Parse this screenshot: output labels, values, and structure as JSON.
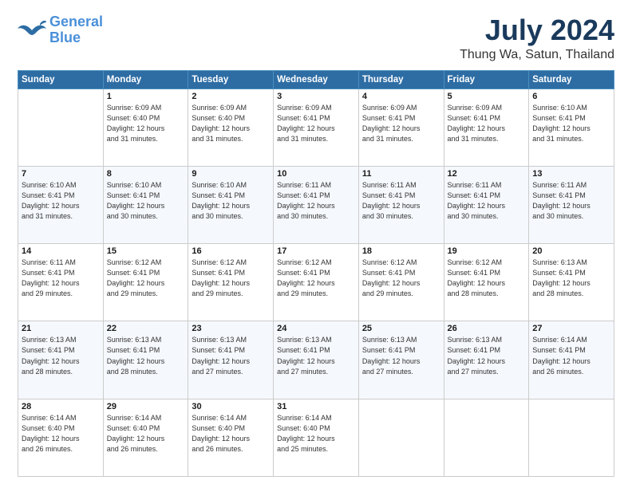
{
  "logo": {
    "line1": "General",
    "line2": "Blue"
  },
  "title": "July 2024",
  "subtitle": "Thung Wa, Satun, Thailand",
  "days_header": [
    "Sunday",
    "Monday",
    "Tuesday",
    "Wednesday",
    "Thursday",
    "Friday",
    "Saturday"
  ],
  "weeks": [
    [
      {
        "day": "",
        "info": ""
      },
      {
        "day": "1",
        "info": "Sunrise: 6:09 AM\nSunset: 6:40 PM\nDaylight: 12 hours\nand 31 minutes."
      },
      {
        "day": "2",
        "info": "Sunrise: 6:09 AM\nSunset: 6:40 PM\nDaylight: 12 hours\nand 31 minutes."
      },
      {
        "day": "3",
        "info": "Sunrise: 6:09 AM\nSunset: 6:41 PM\nDaylight: 12 hours\nand 31 minutes."
      },
      {
        "day": "4",
        "info": "Sunrise: 6:09 AM\nSunset: 6:41 PM\nDaylight: 12 hours\nand 31 minutes."
      },
      {
        "day": "5",
        "info": "Sunrise: 6:09 AM\nSunset: 6:41 PM\nDaylight: 12 hours\nand 31 minutes."
      },
      {
        "day": "6",
        "info": "Sunrise: 6:10 AM\nSunset: 6:41 PM\nDaylight: 12 hours\nand 31 minutes."
      }
    ],
    [
      {
        "day": "7",
        "info": "Sunrise: 6:10 AM\nSunset: 6:41 PM\nDaylight: 12 hours\nand 31 minutes."
      },
      {
        "day": "8",
        "info": "Sunrise: 6:10 AM\nSunset: 6:41 PM\nDaylight: 12 hours\nand 30 minutes."
      },
      {
        "day": "9",
        "info": "Sunrise: 6:10 AM\nSunset: 6:41 PM\nDaylight: 12 hours\nand 30 minutes."
      },
      {
        "day": "10",
        "info": "Sunrise: 6:11 AM\nSunset: 6:41 PM\nDaylight: 12 hours\nand 30 minutes."
      },
      {
        "day": "11",
        "info": "Sunrise: 6:11 AM\nSunset: 6:41 PM\nDaylight: 12 hours\nand 30 minutes."
      },
      {
        "day": "12",
        "info": "Sunrise: 6:11 AM\nSunset: 6:41 PM\nDaylight: 12 hours\nand 30 minutes."
      },
      {
        "day": "13",
        "info": "Sunrise: 6:11 AM\nSunset: 6:41 PM\nDaylight: 12 hours\nand 30 minutes."
      }
    ],
    [
      {
        "day": "14",
        "info": "Sunrise: 6:11 AM\nSunset: 6:41 PM\nDaylight: 12 hours\nand 29 minutes."
      },
      {
        "day": "15",
        "info": "Sunrise: 6:12 AM\nSunset: 6:41 PM\nDaylight: 12 hours\nand 29 minutes."
      },
      {
        "day": "16",
        "info": "Sunrise: 6:12 AM\nSunset: 6:41 PM\nDaylight: 12 hours\nand 29 minutes."
      },
      {
        "day": "17",
        "info": "Sunrise: 6:12 AM\nSunset: 6:41 PM\nDaylight: 12 hours\nand 29 minutes."
      },
      {
        "day": "18",
        "info": "Sunrise: 6:12 AM\nSunset: 6:41 PM\nDaylight: 12 hours\nand 29 minutes."
      },
      {
        "day": "19",
        "info": "Sunrise: 6:12 AM\nSunset: 6:41 PM\nDaylight: 12 hours\nand 28 minutes."
      },
      {
        "day": "20",
        "info": "Sunrise: 6:13 AM\nSunset: 6:41 PM\nDaylight: 12 hours\nand 28 minutes."
      }
    ],
    [
      {
        "day": "21",
        "info": "Sunrise: 6:13 AM\nSunset: 6:41 PM\nDaylight: 12 hours\nand 28 minutes."
      },
      {
        "day": "22",
        "info": "Sunrise: 6:13 AM\nSunset: 6:41 PM\nDaylight: 12 hours\nand 28 minutes."
      },
      {
        "day": "23",
        "info": "Sunrise: 6:13 AM\nSunset: 6:41 PM\nDaylight: 12 hours\nand 27 minutes."
      },
      {
        "day": "24",
        "info": "Sunrise: 6:13 AM\nSunset: 6:41 PM\nDaylight: 12 hours\nand 27 minutes."
      },
      {
        "day": "25",
        "info": "Sunrise: 6:13 AM\nSunset: 6:41 PM\nDaylight: 12 hours\nand 27 minutes."
      },
      {
        "day": "26",
        "info": "Sunrise: 6:13 AM\nSunset: 6:41 PM\nDaylight: 12 hours\nand 27 minutes."
      },
      {
        "day": "27",
        "info": "Sunrise: 6:14 AM\nSunset: 6:41 PM\nDaylight: 12 hours\nand 26 minutes."
      }
    ],
    [
      {
        "day": "28",
        "info": "Sunrise: 6:14 AM\nSunset: 6:40 PM\nDaylight: 12 hours\nand 26 minutes."
      },
      {
        "day": "29",
        "info": "Sunrise: 6:14 AM\nSunset: 6:40 PM\nDaylight: 12 hours\nand 26 minutes."
      },
      {
        "day": "30",
        "info": "Sunrise: 6:14 AM\nSunset: 6:40 PM\nDaylight: 12 hours\nand 26 minutes."
      },
      {
        "day": "31",
        "info": "Sunrise: 6:14 AM\nSunset: 6:40 PM\nDaylight: 12 hours\nand 25 minutes."
      },
      {
        "day": "",
        "info": ""
      },
      {
        "day": "",
        "info": ""
      },
      {
        "day": "",
        "info": ""
      }
    ]
  ]
}
